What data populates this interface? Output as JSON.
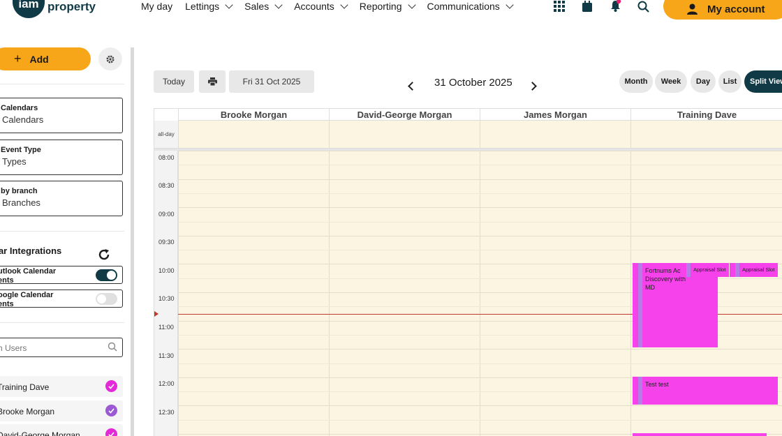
{
  "brand": {
    "logo_mark": "iam",
    "logo_word": "property"
  },
  "nav": [
    {
      "label": "My day",
      "dropdown": false
    },
    {
      "label": "Lettings",
      "dropdown": true
    },
    {
      "label": "Sales",
      "dropdown": true
    },
    {
      "label": "Accounts",
      "dropdown": true
    },
    {
      "label": "Reporting",
      "dropdown": true
    },
    {
      "label": "Communications",
      "dropdown": true
    }
  ],
  "top_icons": [
    "apps-grid-icon",
    "calendar-icon",
    "bell-icon",
    "search-icon"
  ],
  "account_label": "My account",
  "sidebar": {
    "add_label": "Add",
    "filters": [
      {
        "label": "Calendars",
        "value": "Calendars"
      },
      {
        "label": "Event Type",
        "value": "Types"
      },
      {
        "label": "by branch",
        "value": "Branches"
      }
    ],
    "integrations_title": "dar Integrations",
    "integrations": [
      {
        "label_line1": "utlook Calendar",
        "label_line2": "ents",
        "on": true
      },
      {
        "label_line1": "oogle Calendar",
        "label_line2": "ents",
        "on": false
      }
    ],
    "search_placeholder": "h Users",
    "users": [
      {
        "name": "Training Dave",
        "color": "#e329d8"
      },
      {
        "name": "Brooke Morgan",
        "color": "#9b59d6"
      },
      {
        "name": "David-George Morgan",
        "color": "#e329d8"
      }
    ]
  },
  "toolbar": {
    "today_label": "Today",
    "date_chip": "Fri 31 Oct 2025",
    "title": "31 October 2025",
    "views": [
      "Month",
      "Week",
      "Day",
      "List",
      "Split View"
    ],
    "active_view": "Split View"
  },
  "calendar": {
    "columns": [
      "Brooke Morgan",
      "David-George Morgan",
      "James Morgan",
      "Training Dave"
    ],
    "allday_label": "all-day",
    "times": [
      "08:00",
      "08:30",
      "09:00",
      "09:30",
      "10:00",
      "10:30",
      "11:00",
      "11:30",
      "12:00",
      "12:30"
    ],
    "events": [
      {
        "title": "Fortnums Ac Discovery with MD",
        "column": "Training Dave"
      },
      {
        "title": "Appraisal Slot",
        "column": "Training Dave"
      },
      {
        "title": "Appraisal Slot",
        "column": "Training Dave"
      },
      {
        "title": "Test test",
        "column": "Training Dave"
      },
      {
        "title": "",
        "column": "Training Dave"
      }
    ]
  },
  "colors": {
    "accent": "#f8a619",
    "brand_dark": "#0f3a46",
    "event": "#f542ea",
    "now_line": "#c0392b"
  }
}
